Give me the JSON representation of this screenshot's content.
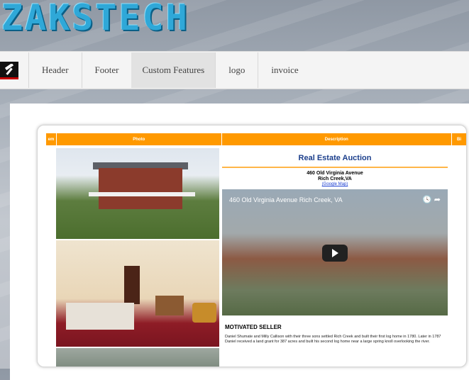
{
  "site": {
    "logo_text": "ZAKSTECH"
  },
  "nav": {
    "items": [
      "Header",
      "Footer",
      "Custom Features",
      "logo",
      "invoice"
    ],
    "active": "Custom Features"
  },
  "listing": {
    "columns": [
      "em",
      "Photo",
      "Description",
      "Bi"
    ],
    "title": "Real Estate Auction",
    "address_line1": "460 Old Virginia Avenue",
    "address_line2": "Rich Creek,VA",
    "map_link": "(Google Map)",
    "video_title": "460 Old Virginia Avenue Rich Creek, VA",
    "section_heading": "MOTIVATED SELLER",
    "paragraph": "Daniel Shumate and Milly Callison with their three sons settled Rich Creek and built their first log home in 1780. Later in 1787 Daniel received a land grant for 387 acres and built his second log home near a large spring knoll overlooking the river."
  },
  "colors": {
    "accent": "#ff9900",
    "title_blue": "#1c3f8c"
  }
}
